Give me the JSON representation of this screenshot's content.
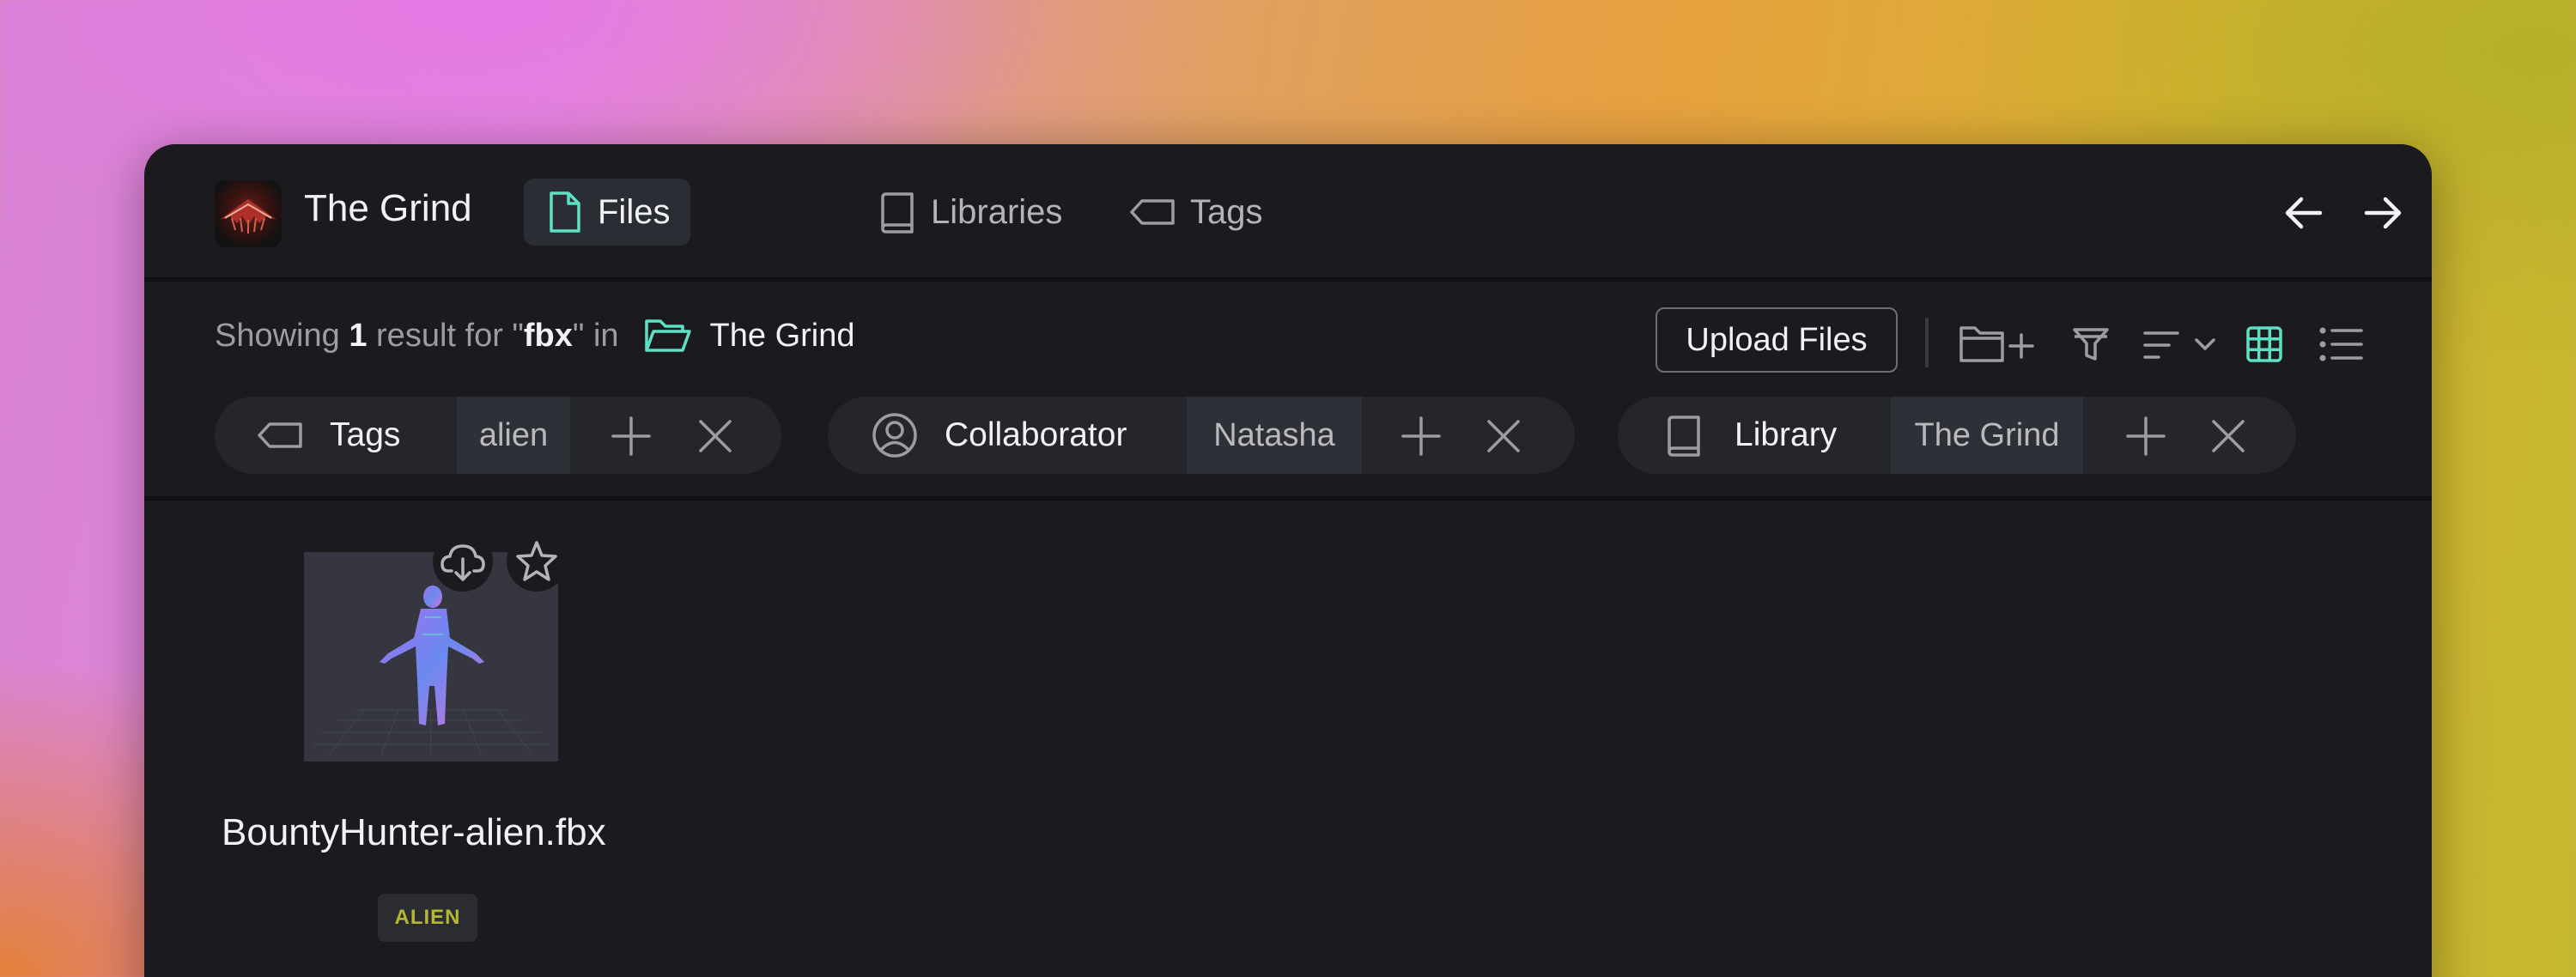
{
  "app": {
    "title": "The Grind"
  },
  "nav": {
    "files": "Files",
    "libraries": "Libraries",
    "tags": "Tags"
  },
  "search": {
    "prefix": "Showing",
    "count": "1",
    "mid": "result for \"",
    "query": "fbx",
    "suffix": "\" in",
    "location": "The Grind"
  },
  "toolbar": {
    "upload_label": "Upload Files"
  },
  "filters": [
    {
      "key": "Tags",
      "value": "alien",
      "icon": "tag-icon"
    },
    {
      "key": "Collaborator",
      "value": "Natasha",
      "icon": "user-circle-icon"
    },
    {
      "key": "Library",
      "value": "The Grind",
      "icon": "book-icon"
    }
  ],
  "files": [
    {
      "name": "BountyHunter-alien.fbx",
      "tag": "ALIEN"
    }
  ],
  "colors": {
    "accent": "#5ee0c4",
    "tag_text": "#b5b832",
    "background": "#1b1b1f"
  }
}
